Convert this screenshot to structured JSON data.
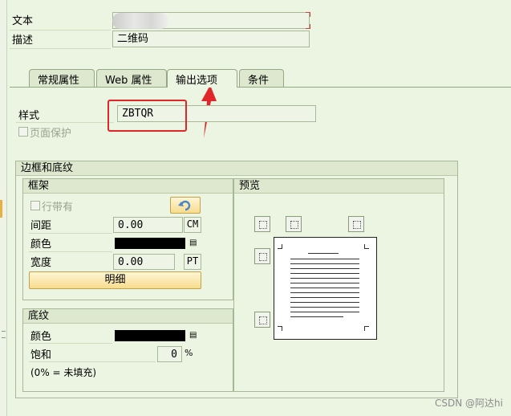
{
  "header": {
    "text_label": "文本",
    "text_value": "",
    "desc_label": "描述",
    "desc_value": "二维码"
  },
  "tabs": [
    {
      "label": "常规属性",
      "active": false
    },
    {
      "label": "Web 属性",
      "active": false
    },
    {
      "label": "输出选项",
      "active": true
    },
    {
      "label": "条件",
      "active": false
    }
  ],
  "style": {
    "label": "样式",
    "value": "ZBTQR",
    "page_protect_label": "页面保护",
    "page_protect_checked": false
  },
  "border_shading": {
    "title": "边框和底纹",
    "frame": {
      "title": "框架",
      "with_line_label": "行带有",
      "with_line_checked": false,
      "undo_icon": "undo-arrow-icon",
      "spacing_label": "间距",
      "spacing_value": "0.00",
      "spacing_unit": "CM",
      "color_label": "颜色",
      "color_value": "#000000",
      "width_label": "宽度",
      "width_value": "0.00",
      "width_unit": "PT",
      "details_button": "明细"
    },
    "shading": {
      "title": "底纹",
      "color_label": "颜色",
      "color_value": "#000000",
      "saturation_label": "饱和",
      "saturation_value": "0",
      "saturation_unit": "%",
      "note": "(0% = 未填充)"
    },
    "preview": {
      "title": "预览"
    }
  },
  "annotation": {
    "highlight_color": "#e0262a"
  },
  "watermark": "CSDN @阿达hi"
}
